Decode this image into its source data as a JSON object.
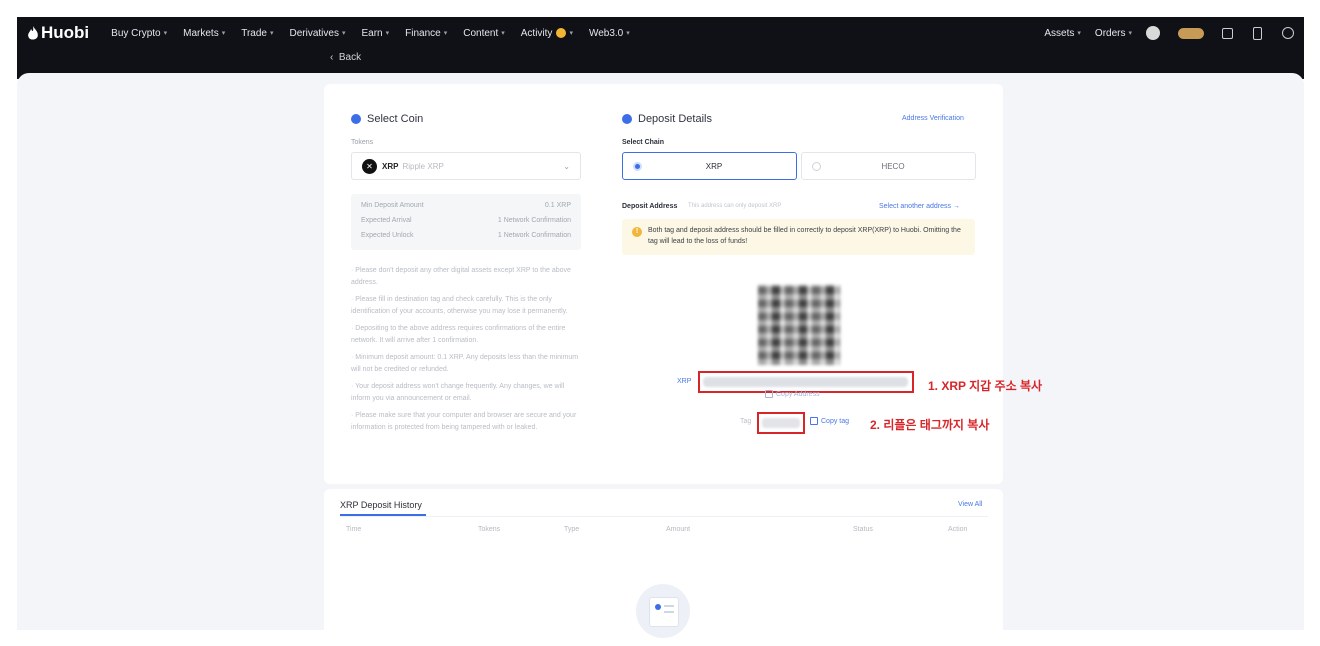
{
  "brand": {
    "name": "Huobi"
  },
  "nav": {
    "left": [
      "Buy Crypto",
      "Markets",
      "Trade",
      "Derivatives",
      "Earn",
      "Finance",
      "Content",
      "Activity",
      "Web3.0"
    ],
    "right": [
      "Assets",
      "Orders"
    ]
  },
  "back_label": "Back",
  "select_coin": {
    "title": "Select Coin",
    "field_label": "Tokens",
    "coin_code": "XRP",
    "coin_name": "Ripple XRP",
    "info": [
      {
        "label": "Min Deposit Amount",
        "value": "0.1 XRP"
      },
      {
        "label": "Expected Arrival",
        "value": "1 Network Confirmation"
      },
      {
        "label": "Expected Unlock",
        "value": "1 Network Confirmation"
      }
    ],
    "notes": [
      "· Please don't deposit any other digital assets except XRP to the above address.",
      "· Please fill in destination tag and check carefully. This is the only identification of your accounts, otherwise you may lose it permanently.",
      "· Depositing to the above address requires confirmations of the entire network. It will arrive after 1 confirmation.",
      "· Minimum deposit amount: 0.1 XRP. Any deposits less than the minimum will not be credited or refunded.",
      "· Your deposit address won't change frequently. Any changes, we will inform you via announcement or email.",
      "· Please make sure that your computer and browser are secure and your information is protected from being tampered with or leaked."
    ]
  },
  "deposit_details": {
    "title": "Deposit Details",
    "address_verification": "Address Verification",
    "select_chain_label": "Select Chain",
    "chains": [
      {
        "name": "XRP",
        "selected": true
      },
      {
        "name": "HECO",
        "selected": false
      }
    ],
    "deposit_address_label": "Deposit Address",
    "deposit_address_hint": "This address can only deposit XRP",
    "select_another": "Select another address",
    "warning": "Both tag and deposit address should be filled in correctly to deposit XRP(XRP) to Huobi. Omitting the tag will lead to the loss of funds!",
    "address_prefix": "XRP",
    "copy_address": "Copy Address",
    "tag_label": "Tag",
    "copy_tag": "Copy tag"
  },
  "annotations": {
    "step1": "1. XRP 지갑 주소 복사",
    "step2": "2. 리플은 태그까지 복사",
    "color": "#d7262a"
  },
  "history": {
    "title": "XRP Deposit History",
    "view_all": "View All",
    "columns": [
      "Time",
      "Tokens",
      "Type",
      "Amount",
      "Status",
      "Action"
    ]
  },
  "colors": {
    "accent": "#3c6ee8",
    "nav_bg": "#0f1117",
    "warning_bg": "#fdf8e6"
  }
}
